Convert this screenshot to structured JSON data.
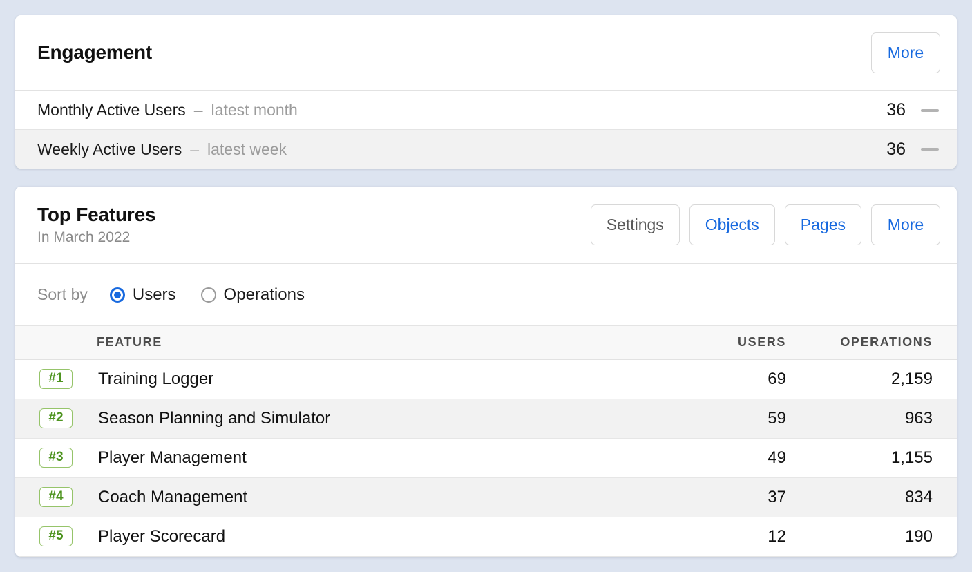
{
  "engagement": {
    "title": "Engagement",
    "more_label": "More",
    "rows": [
      {
        "label": "Monthly Active Users",
        "separator": "–",
        "period": "latest month",
        "value": "36",
        "trend": "flat"
      },
      {
        "label": "Weekly Active Users",
        "separator": "–",
        "period": "latest week",
        "value": "36",
        "trend": "flat"
      }
    ]
  },
  "top_features": {
    "title": "Top Features",
    "subtitle": "In March 2022",
    "buttons": [
      {
        "label": "Settings",
        "style": "muted"
      },
      {
        "label": "Objects",
        "style": "link"
      },
      {
        "label": "Pages",
        "style": "link"
      },
      {
        "label": "More",
        "style": "link"
      }
    ],
    "sort": {
      "label": "Sort by",
      "options": [
        {
          "label": "Users",
          "selected": true
        },
        {
          "label": "Operations",
          "selected": false
        }
      ]
    },
    "table": {
      "headers": {
        "rank": "",
        "feature": "FEATURE",
        "users": "USERS",
        "operations": "OPERATIONS"
      },
      "rows": [
        {
          "rank": "#1",
          "feature": "Training Logger",
          "users": "69",
          "operations": "2,159"
        },
        {
          "rank": "#2",
          "feature": "Season Planning and Simulator",
          "users": "59",
          "operations": "963"
        },
        {
          "rank": "#3",
          "feature": "Player Management",
          "users": "49",
          "operations": "1,155"
        },
        {
          "rank": "#4",
          "feature": "Coach Management",
          "users": "37",
          "operations": "834"
        },
        {
          "rank": "#5",
          "feature": "Player Scorecard",
          "users": "12",
          "operations": "190"
        }
      ]
    }
  },
  "colors": {
    "page_background": "#dde4f0",
    "link_blue": "#1769df",
    "rank_green_text": "#4e9420",
    "rank_green_border": "#96c46a",
    "muted_gray": "#8a8a8a",
    "row_alt": "#f2f2f2"
  }
}
